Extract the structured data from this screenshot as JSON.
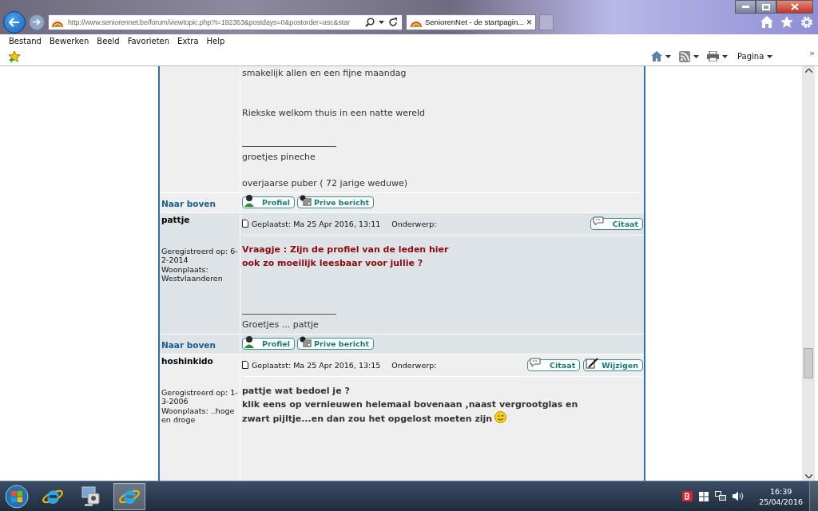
{
  "browser": {
    "address": "http://www.seniorennet.be/forum/viewtopic.php?t=192363&postdays=0&postorder=asc&star",
    "tab": {
      "title": "SeniorenNet - de startpagin...",
      "close": "×"
    },
    "menu": [
      "Bestand",
      "Bewerken",
      "Beeld",
      "Favorieten",
      "Extra",
      "Help"
    ],
    "page_menu": "Pagina",
    "overflow": "»"
  },
  "posts": [
    {
      "kind": "plain",
      "body": [
        "smakelijk allen en een fijne maandag",
        "Riekske welkom thuis in een natte wereld"
      ],
      "signature": [
        "groetjes pineche",
        "overjaarse puber ( 72 jarige weduwe)"
      ],
      "footer": {
        "link": "Naar boven",
        "buttons": [
          {
            "kind": "profile",
            "label": "Profiel"
          },
          {
            "kind": "pm",
            "label": "Prive bericht"
          }
        ]
      }
    },
    {
      "author": "pattje",
      "details": [
        "Geregistreerd op: 6-2-2014",
        "Woonplaats: Westvlaanderen"
      ],
      "posted": "Geplaatst: Ma 25 Apr 2016, 13:11",
      "subject_label": "Onderwerp:",
      "actions": [
        {
          "kind": "quote",
          "label": "Citaat"
        }
      ],
      "kind": "alert",
      "body": [
        "Vraagje : Zijn de profiel van de leden hier",
        "ook zo moeilijk leesbaar voor jullie ?"
      ],
      "signature": [
        "Groetjes ... pattje"
      ],
      "footer": {
        "link": "Naar boven",
        "buttons": [
          {
            "kind": "profile",
            "label": "Profiel"
          },
          {
            "kind": "pm",
            "label": "Prive bericht"
          }
        ]
      }
    },
    {
      "author": "hoshinkido",
      "details": [
        "Geregistreerd op: 1-3-2006",
        "Woonplaats: ..hoge en droge"
      ],
      "posted": "Geplaatst: Ma 25 Apr 2016, 13:15",
      "subject_label": "Onderwerp:",
      "actions": [
        {
          "kind": "quote",
          "label": "Citaat"
        },
        {
          "kind": "edit",
          "label": "Wijzigen"
        }
      ],
      "kind": "bold",
      "body": [
        "pattje wat bedoel je ?",
        "klik eens op vernieuwen helemaal bovenaan ,naast vergrootglas en",
        "zwart pijltje...en dan zou het opgelost moeten zijn"
      ],
      "emoticon": true
    }
  ],
  "taskbar": {
    "apps": [
      {
        "kind": "ie",
        "selected": false
      },
      {
        "kind": "remote",
        "selected": false
      },
      {
        "kind": "ie",
        "selected": true
      }
    ],
    "time": "16:39",
    "date": "25/04/2016"
  }
}
